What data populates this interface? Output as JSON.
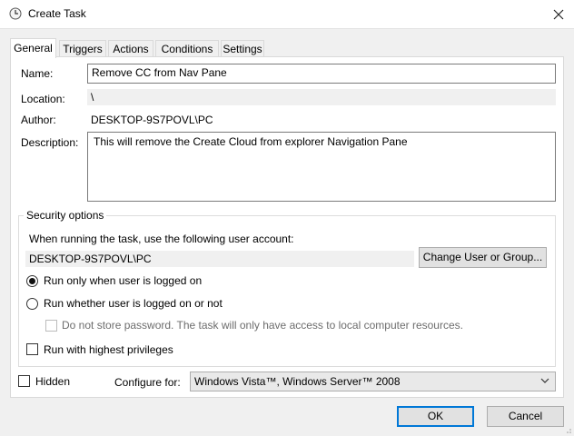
{
  "window": {
    "title": "Create Task",
    "title_icon": "clock-icon",
    "close_icon": "close-icon"
  },
  "tabs": [
    {
      "label": "General",
      "active": true
    },
    {
      "label": "Triggers"
    },
    {
      "label": "Actions"
    },
    {
      "label": "Conditions"
    },
    {
      "label": "Settings"
    }
  ],
  "general": {
    "name_label": "Name:",
    "name_value": "Remove CC from Nav Pane",
    "location_label": "Location:",
    "location_value": "\\",
    "author_label": "Author:",
    "author_value": "DESKTOP-9S7POVL\\PC",
    "description_label": "Description:",
    "description_value": "This will remove the Create Cloud from explorer Navigation Pane"
  },
  "security": {
    "group_title": "Security options",
    "account_prompt": "When running the task, use the following user account:",
    "account_value": "DESKTOP-9S7POVL\\PC",
    "change_button": "Change User or Group...",
    "radio_logged_on": "Run only when user is logged on",
    "radio_logged_on_selected": true,
    "radio_whether": "Run whether user is logged on or not",
    "no_store_password": "Do not store password.  The task will only have access to local computer resources.",
    "highest_privileges": "Run with highest privileges"
  },
  "bottom": {
    "hidden_label": "Hidden",
    "configure_label": "Configure for:",
    "configure_value": "Windows Vista™, Windows Server™ 2008"
  },
  "buttons": {
    "ok": "OK",
    "cancel": "Cancel"
  },
  "colors": {
    "accent": "#0078d7",
    "window_bg": "#f0f0f0"
  }
}
